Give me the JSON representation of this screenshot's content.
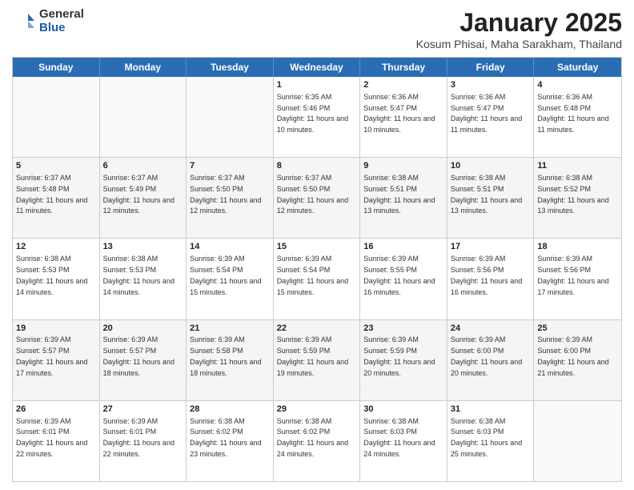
{
  "logo": {
    "general": "General",
    "blue": "Blue"
  },
  "header": {
    "month": "January 2025",
    "location": "Kosum Phisai, Maha Sarakham, Thailand"
  },
  "weekdays": [
    "Sunday",
    "Monday",
    "Tuesday",
    "Wednesday",
    "Thursday",
    "Friday",
    "Saturday"
  ],
  "rows": [
    [
      {
        "day": "",
        "text": ""
      },
      {
        "day": "",
        "text": ""
      },
      {
        "day": "",
        "text": ""
      },
      {
        "day": "1",
        "text": "Sunrise: 6:35 AM\nSunset: 5:46 PM\nDaylight: 11 hours and 10 minutes."
      },
      {
        "day": "2",
        "text": "Sunrise: 6:36 AM\nSunset: 5:47 PM\nDaylight: 11 hours and 10 minutes."
      },
      {
        "day": "3",
        "text": "Sunrise: 6:36 AM\nSunset: 5:47 PM\nDaylight: 11 hours and 11 minutes."
      },
      {
        "day": "4",
        "text": "Sunrise: 6:36 AM\nSunset: 5:48 PM\nDaylight: 11 hours and 11 minutes."
      }
    ],
    [
      {
        "day": "5",
        "text": "Sunrise: 6:37 AM\nSunset: 5:48 PM\nDaylight: 11 hours and 11 minutes."
      },
      {
        "day": "6",
        "text": "Sunrise: 6:37 AM\nSunset: 5:49 PM\nDaylight: 11 hours and 12 minutes."
      },
      {
        "day": "7",
        "text": "Sunrise: 6:37 AM\nSunset: 5:50 PM\nDaylight: 11 hours and 12 minutes."
      },
      {
        "day": "8",
        "text": "Sunrise: 6:37 AM\nSunset: 5:50 PM\nDaylight: 11 hours and 12 minutes."
      },
      {
        "day": "9",
        "text": "Sunrise: 6:38 AM\nSunset: 5:51 PM\nDaylight: 11 hours and 13 minutes."
      },
      {
        "day": "10",
        "text": "Sunrise: 6:38 AM\nSunset: 5:51 PM\nDaylight: 11 hours and 13 minutes."
      },
      {
        "day": "11",
        "text": "Sunrise: 6:38 AM\nSunset: 5:52 PM\nDaylight: 11 hours and 13 minutes."
      }
    ],
    [
      {
        "day": "12",
        "text": "Sunrise: 6:38 AM\nSunset: 5:53 PM\nDaylight: 11 hours and 14 minutes."
      },
      {
        "day": "13",
        "text": "Sunrise: 6:38 AM\nSunset: 5:53 PM\nDaylight: 11 hours and 14 minutes."
      },
      {
        "day": "14",
        "text": "Sunrise: 6:39 AM\nSunset: 5:54 PM\nDaylight: 11 hours and 15 minutes."
      },
      {
        "day": "15",
        "text": "Sunrise: 6:39 AM\nSunset: 5:54 PM\nDaylight: 11 hours and 15 minutes."
      },
      {
        "day": "16",
        "text": "Sunrise: 6:39 AM\nSunset: 5:55 PM\nDaylight: 11 hours and 16 minutes."
      },
      {
        "day": "17",
        "text": "Sunrise: 6:39 AM\nSunset: 5:56 PM\nDaylight: 11 hours and 16 minutes."
      },
      {
        "day": "18",
        "text": "Sunrise: 6:39 AM\nSunset: 5:56 PM\nDaylight: 11 hours and 17 minutes."
      }
    ],
    [
      {
        "day": "19",
        "text": "Sunrise: 6:39 AM\nSunset: 5:57 PM\nDaylight: 11 hours and 17 minutes."
      },
      {
        "day": "20",
        "text": "Sunrise: 6:39 AM\nSunset: 5:57 PM\nDaylight: 11 hours and 18 minutes."
      },
      {
        "day": "21",
        "text": "Sunrise: 6:39 AM\nSunset: 5:58 PM\nDaylight: 11 hours and 18 minutes."
      },
      {
        "day": "22",
        "text": "Sunrise: 6:39 AM\nSunset: 5:59 PM\nDaylight: 11 hours and 19 minutes."
      },
      {
        "day": "23",
        "text": "Sunrise: 6:39 AM\nSunset: 5:59 PM\nDaylight: 11 hours and 20 minutes."
      },
      {
        "day": "24",
        "text": "Sunrise: 6:39 AM\nSunset: 6:00 PM\nDaylight: 11 hours and 20 minutes."
      },
      {
        "day": "25",
        "text": "Sunrise: 6:39 AM\nSunset: 6:00 PM\nDaylight: 11 hours and 21 minutes."
      }
    ],
    [
      {
        "day": "26",
        "text": "Sunrise: 6:39 AM\nSunset: 6:01 PM\nDaylight: 11 hours and 22 minutes."
      },
      {
        "day": "27",
        "text": "Sunrise: 6:39 AM\nSunset: 6:01 PM\nDaylight: 11 hours and 22 minutes."
      },
      {
        "day": "28",
        "text": "Sunrise: 6:38 AM\nSunset: 6:02 PM\nDaylight: 11 hours and 23 minutes."
      },
      {
        "day": "29",
        "text": "Sunrise: 6:38 AM\nSunset: 6:02 PM\nDaylight: 11 hours and 24 minutes."
      },
      {
        "day": "30",
        "text": "Sunrise: 6:38 AM\nSunset: 6:03 PM\nDaylight: 11 hours and 24 minutes."
      },
      {
        "day": "31",
        "text": "Sunrise: 6:38 AM\nSunset: 6:03 PM\nDaylight: 11 hours and 25 minutes."
      },
      {
        "day": "",
        "text": ""
      }
    ]
  ]
}
